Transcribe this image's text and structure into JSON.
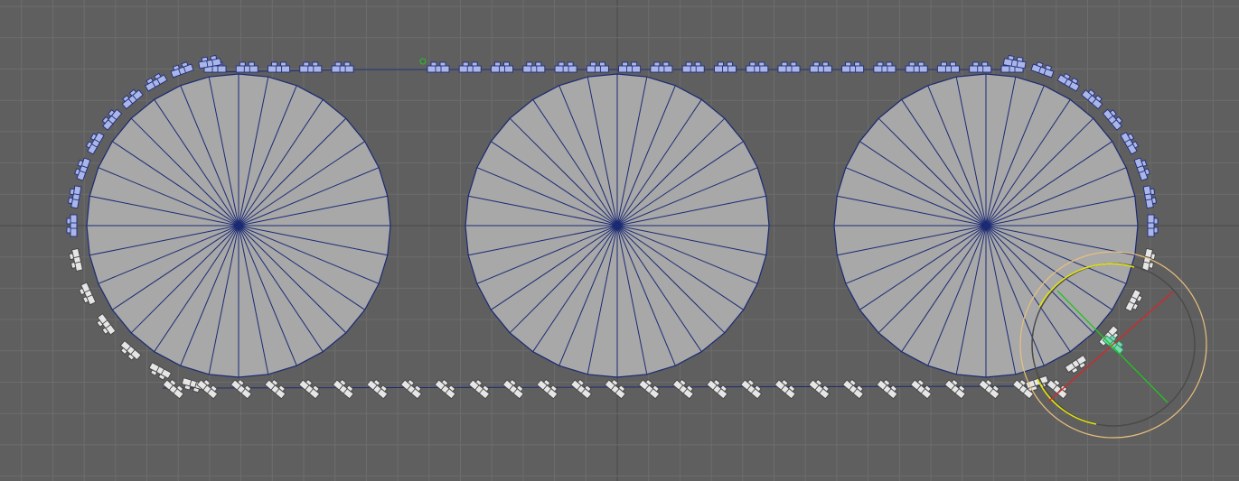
{
  "viewport": {
    "panel": "orthographic-side-view",
    "background_color": "#5f5f5f",
    "grid_color": "#6d6d6d",
    "grid_axis_color": "#4a4a4a"
  },
  "scene": {
    "wheels": [
      {
        "name": "wheel-left",
        "segments": 32,
        "face_color": "#a8a8a8",
        "edge_color": "#1b2a73"
      },
      {
        "name": "wheel-center",
        "segments": 32,
        "face_color": "#a8a8a8",
        "edge_color": "#1b2a73"
      },
      {
        "name": "wheel-right",
        "segments": 32,
        "face_color": "#a8a8a8",
        "edge_color": "#1b2a73"
      }
    ],
    "track": {
      "path_color": "#1b2a73",
      "highlighted_link_color": "#1f2d7a",
      "unselected_link_color": "#e6e6e6",
      "active_link_color": "#79d9b0",
      "top_link_count": 26,
      "bottom_link_count": 27,
      "left_arc_highlighted_links": 9,
      "left_arc_unselected_links": 6,
      "right_arc_highlighted_links": 9,
      "right_arc_unselected_links": 5
    },
    "manipulator": {
      "tool": "rotate",
      "outer_ring_color": "#e8c07c",
      "view_ring_color": "#4a4a4a",
      "axis_ring_color": "#e6e600",
      "x_axis_color": "#d82626",
      "y_axis_color": "#22c422"
    }
  }
}
